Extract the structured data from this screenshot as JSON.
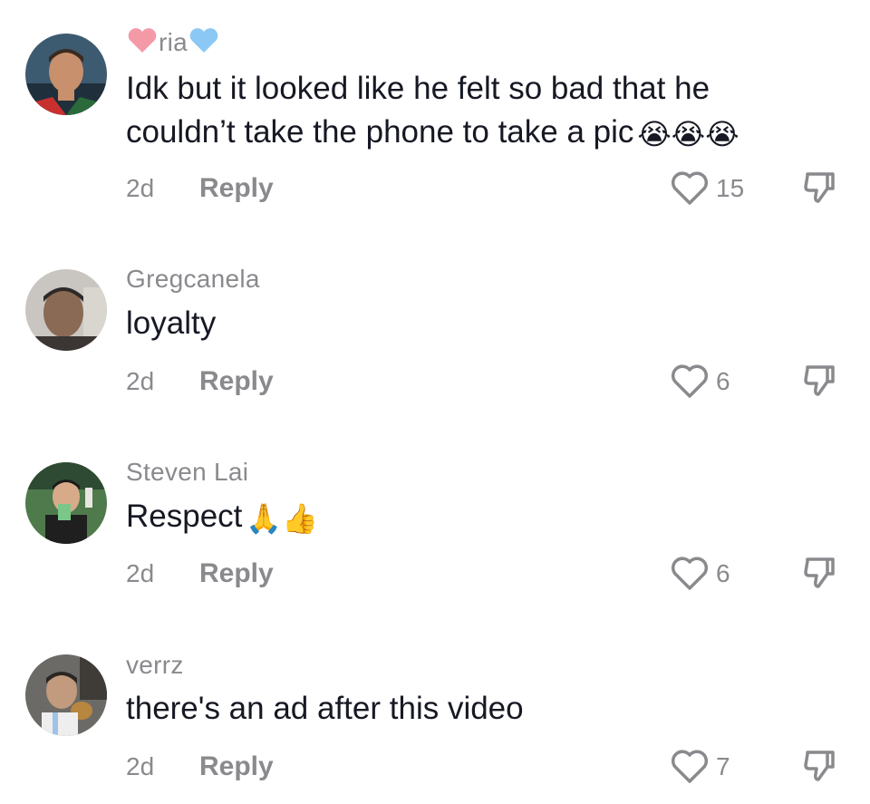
{
  "comments": [
    {
      "username": "ria",
      "text": "Idk but it looked like he felt so bad that he",
      "text2": "couldn’t take the phone to take a pic",
      "emoji": "😭😭😭",
      "time": "2d",
      "reply": "Reply",
      "likes": "15"
    },
    {
      "username": "Gregcanela",
      "text": "loyalty",
      "time": "2d",
      "reply": "Reply",
      "likes": "6"
    },
    {
      "username": "Steven Lai",
      "text": "Respect",
      "emoji": "🙏👍",
      "time": "2d",
      "reply": "Reply",
      "likes": "6"
    },
    {
      "username": "verrz",
      "text": "there's an ad after this video",
      "time": "2d",
      "reply": "Reply",
      "likes": "7"
    }
  ],
  "icons": {
    "like": "heart-outline-icon",
    "dislike": "thumbs-down-icon",
    "name_decoration_left": "pink-heart-icon",
    "name_decoration_right": "blue-heart-icon"
  },
  "colors": {
    "secondary_text": "#8a8a8e",
    "primary_text": "#161823"
  }
}
